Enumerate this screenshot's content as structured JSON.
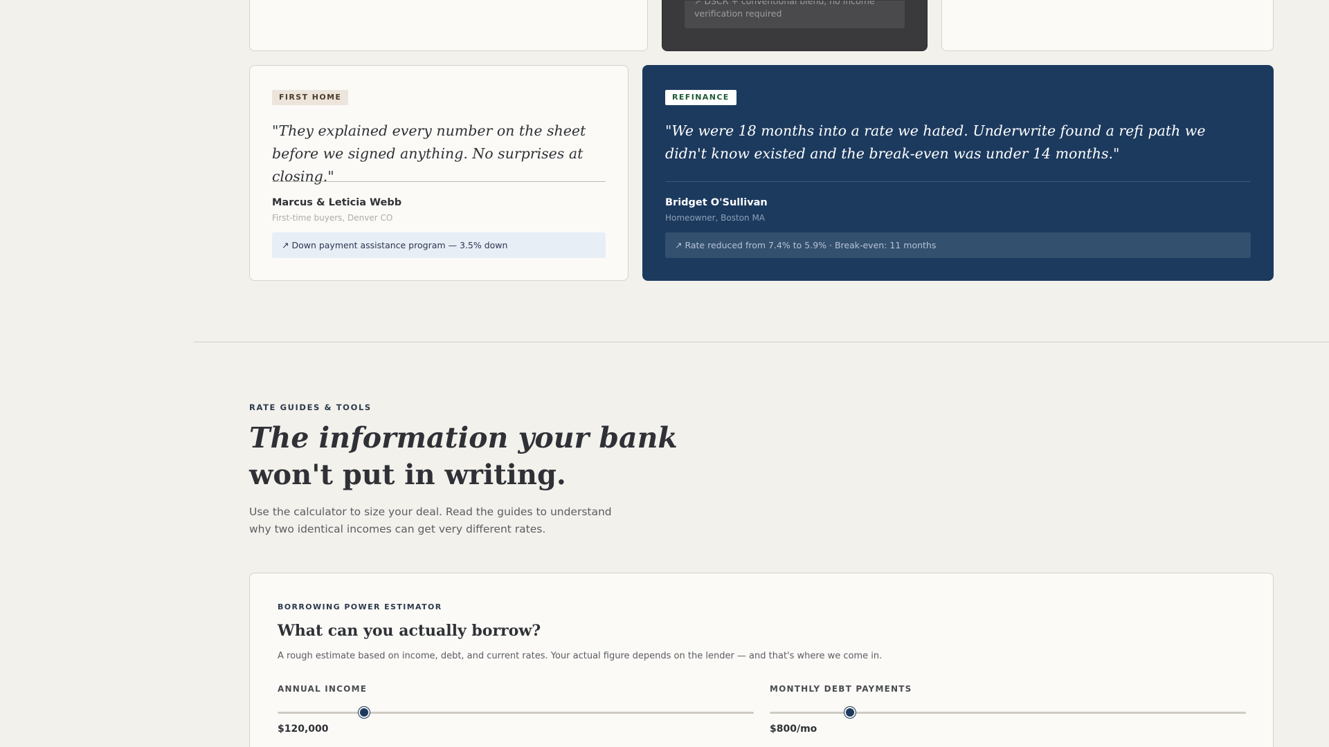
{
  "upper_cards": {
    "dark_result": "↗ DSCR + conventional blend, no income verification required"
  },
  "testimonials": [
    {
      "badge": "FIRST HOME",
      "quote": "\"They explained every number on the sheet before we signed anything. No surprises at closing.\"",
      "name": "Marcus & Leticia Webb",
      "role": "First-time buyers, Denver CO",
      "result": "↗ Down payment assistance program — 3.5% down"
    },
    {
      "badge": "REFINANCE",
      "quote": "\"We were 18 months into a rate we hated. Underwrite found a refi path we didn't know existed and the break-even was under 14 months.\"",
      "name": "Bridget O'Sullivan",
      "role": "Homeowner, Boston MA",
      "result": "↗ Rate reduced from 7.4% to 5.9% · Break-even: 11 months"
    }
  ],
  "rate_guides": {
    "eyebrow": "RATE GUIDES & TOOLS",
    "headline_line1": "The information your bank",
    "headline_line2": "won't put in writing.",
    "lede": "Use the calculator to size your deal. Read the guides to understand why two identical incomes can get very different rates."
  },
  "calculator": {
    "eyebrow": "BORROWING POWER ESTIMATOR",
    "title": "What can you actually borrow?",
    "description": "A rough estimate based on income, debt, and current rates. Your actual figure depends on the lender — and that's where we come in.",
    "income": {
      "label": "ANNUAL INCOME",
      "value": "$120,000",
      "slider_fraction": 0.182
    },
    "debt": {
      "label": "MONTHLY DEBT PAYMENTS",
      "value": "$800/mo",
      "slider_fraction": 0.168
    }
  },
  "colors": {
    "navy": "#1c3a5e",
    "dark_card": "#3a3a3c",
    "page_bg": "#f3f1ec"
  }
}
